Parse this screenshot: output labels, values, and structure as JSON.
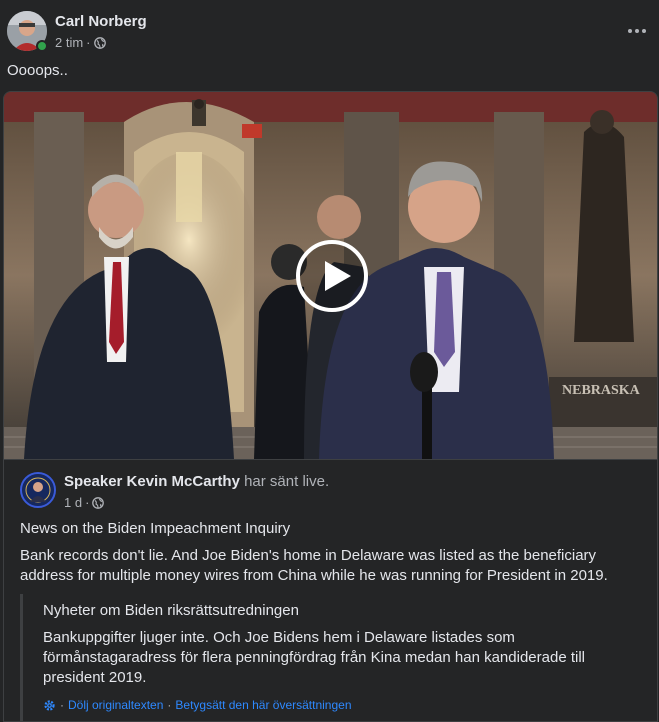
{
  "post": {
    "author": "Carl Norberg",
    "time": "2 tim",
    "separator": "·",
    "audience_icon": "globe-icon",
    "text": "Oooops..",
    "more_icon": "more-dots-icon"
  },
  "shared": {
    "video": {
      "play_icon": "play-icon"
    },
    "page_name": "Speaker Kevin McCarthy",
    "page_action": "har sänt live.",
    "time": "1 d",
    "separator": "·",
    "audience_icon": "globe-icon",
    "title": "News on the Biden Impeachment Inquiry",
    "body": "Bank records don't lie. And Joe Biden's home in Delaware was listed as the beneficiary address for multiple money wires from China while he was running for President in 2019.",
    "translation": {
      "title": "Nyheter om Biden riksrättsutredningen",
      "body": "Bankuppgifter ljuger inte. Och Joe Bidens hem i Delaware listades som förmånstagaradress för flera penningfördrag från Kina medan han kandiderade till president 2019.",
      "gear_icon": "gear-icon",
      "hide_original": "Dölj originaltexten",
      "rate_translation": "Betygsätt den här översättningen",
      "separator": "·"
    }
  },
  "colors": {
    "background": "#242526",
    "text_primary": "#e4e6eb",
    "text_secondary": "#b0b3b8",
    "link": "#2e89ff",
    "online": "#31a24c"
  }
}
